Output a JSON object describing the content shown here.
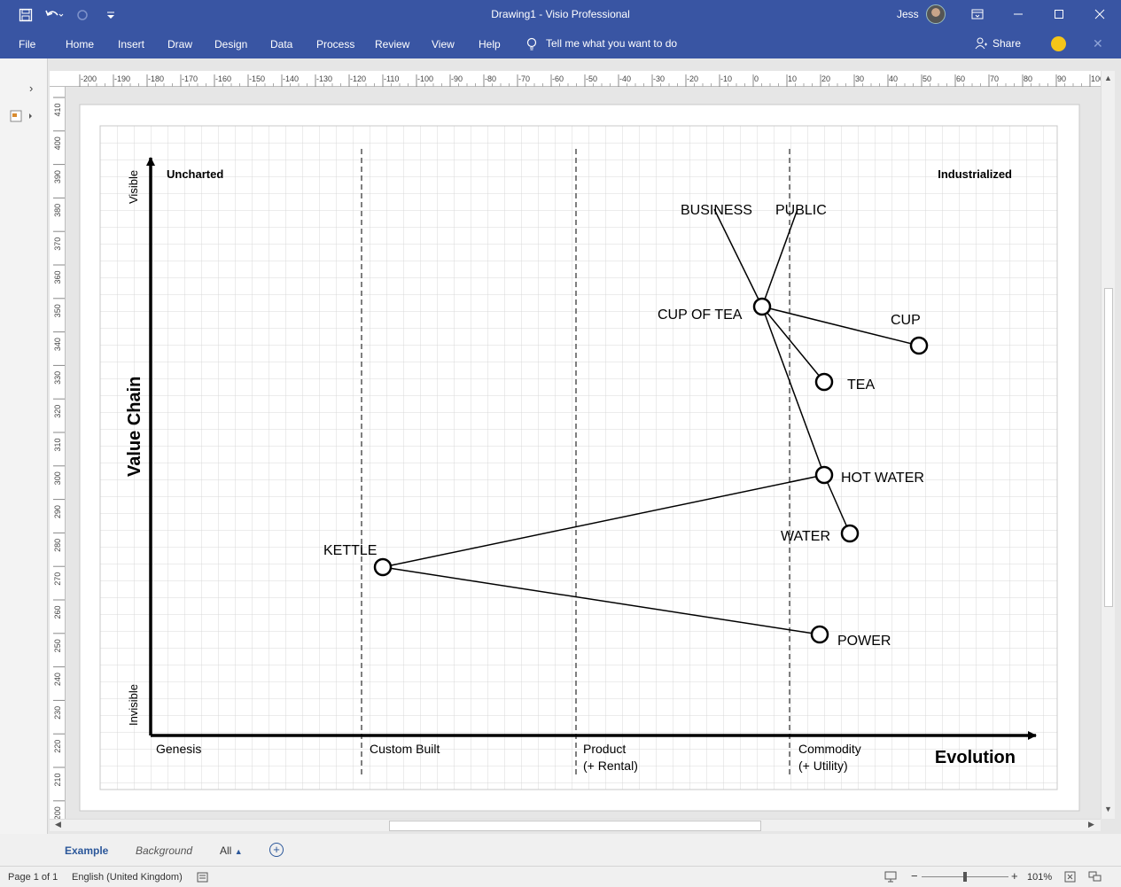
{
  "titlebar": {
    "document_title": "Drawing1  -  Visio Professional",
    "user_name": "Jess"
  },
  "ribbon": {
    "menu": [
      "File",
      "Home",
      "Insert",
      "Draw",
      "Design",
      "Data",
      "Process",
      "Review",
      "View",
      "Help"
    ],
    "tell_me": "Tell me what you want to do",
    "share_label": "Share"
  },
  "rulers": {
    "horizontal_ticks": [
      "-200",
      "-190",
      "-180",
      "-170",
      "-160",
      "-150",
      "-140",
      "-130",
      "-120",
      "-110",
      "-100",
      "-90",
      "-80",
      "-70",
      "-60",
      "-50",
      "-40",
      "-30",
      "-20",
      "-10",
      "0",
      "10",
      "20",
      "30",
      "40",
      "50",
      "60",
      "70",
      "80",
      "90",
      "100"
    ],
    "vertical_ticks": [
      "410",
      "400",
      "390",
      "380",
      "370",
      "360",
      "350",
      "340",
      "330",
      "320",
      "310",
      "300",
      "290",
      "280",
      "270",
      "260",
      "250",
      "240",
      "230",
      "220",
      "210",
      "200"
    ]
  },
  "map": {
    "y_axis_title": "Value Chain",
    "y_top_label": "Visible",
    "y_bottom_label": "Invisible",
    "x_axis_title": "Evolution",
    "top_left_label": "Uncharted",
    "top_right_label": "Industrialized",
    "stages": [
      {
        "line1": "Genesis",
        "line2": ""
      },
      {
        "line1": "Custom Built",
        "line2": ""
      },
      {
        "line1": "Product",
        "line2": "(+ Rental)"
      },
      {
        "line1": "Commodity",
        "line2": "(+ Utility)"
      }
    ],
    "components": {
      "business": "BUSINESS",
      "public": "PUBLIC",
      "cup_of_tea": "CUP OF TEA",
      "cup": "CUP",
      "tea": "TEA",
      "hot_water": "HOT WATER",
      "water": "WATER",
      "kettle": "KETTLE",
      "power": "POWER"
    }
  },
  "sheet_tabs": {
    "active": "Example",
    "background": "Background",
    "all": "All"
  },
  "statusbar": {
    "page": "Page 1 of 1",
    "language": "English (United Kingdom)",
    "zoom": "101%"
  },
  "colors": {
    "accent": "#3955a3",
    "active_tab": "#2b579a"
  }
}
